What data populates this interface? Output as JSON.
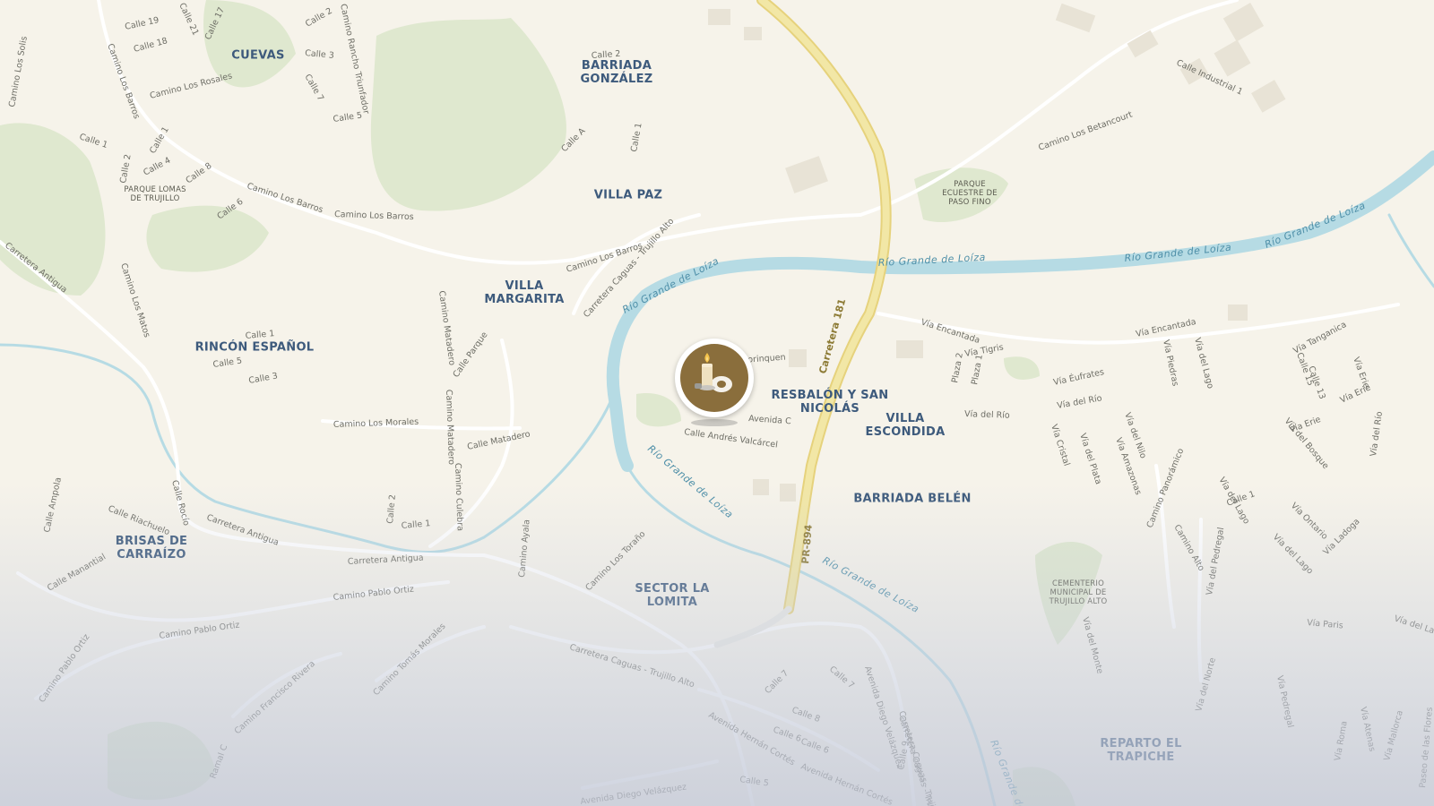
{
  "map": {
    "neighborhoods": [
      {
        "id": "cuevas",
        "name": "CUEVAS"
      },
      {
        "id": "barriada-gonzalez",
        "name": "BARRIADA\nGONZÁLEZ"
      },
      {
        "id": "villa-paz",
        "name": "VILLA PAZ"
      },
      {
        "id": "villa-margarita",
        "name": "VILLA\nMARGARITA"
      },
      {
        "id": "rincon-espanol",
        "name": "RINCÓN ESPAÑOL"
      },
      {
        "id": "resbalon",
        "name": "RESBALÓN Y SAN\nNICOLÁS"
      },
      {
        "id": "villa-escondida",
        "name": "VILLA\nESCONDIDA"
      },
      {
        "id": "barriada-belen",
        "name": "BARRIADA BELÉN"
      },
      {
        "id": "brisas",
        "name": "BRISAS DE\nCARRAÍZO"
      },
      {
        "id": "sector-la-lomita",
        "name": "SECTOR LA\nLOMITA"
      },
      {
        "id": "reparto-el-trapiche",
        "name": "REPARTO EL\nTRAPICHE"
      }
    ],
    "pois": [
      {
        "id": "parque-lomas",
        "name": "PARQUE LOMAS\nDE TRUJILLO"
      },
      {
        "id": "parque-ecuestre",
        "name": "PARQUE\nECUESTRE DE\nPASO FINO"
      },
      {
        "id": "cementerio",
        "name": "CEMENTERIO\nMUNICIPAL DE\nTRUJILLO ALTO"
      }
    ],
    "rivers": [
      {
        "id": "r1",
        "name": "Río Grande de Loíza"
      },
      {
        "id": "r2",
        "name": "Río Grande de Loíza"
      },
      {
        "id": "r3",
        "name": "Río Grande de Loíza"
      },
      {
        "id": "r4",
        "name": "Río Grande de Loíza"
      },
      {
        "id": "r5",
        "name": "Río Grande de Loíza"
      },
      {
        "id": "r6",
        "name": "Río Grande de Loíza"
      },
      {
        "id": "r7",
        "name": "Río Grande de Loíza"
      }
    ],
    "highways": [
      {
        "id": "carretera-181",
        "name": "Carretera 181"
      },
      {
        "id": "pr-894",
        "name": "PR-894"
      }
    ],
    "streets": [
      {
        "id": "s1",
        "name": "Camino Los Barros"
      },
      {
        "id": "s2",
        "name": "Camino Los Barros"
      },
      {
        "id": "s3",
        "name": "Camino Los Barros"
      },
      {
        "id": "s4",
        "name": "Camino Los Barros"
      },
      {
        "id": "s5",
        "name": "Carretera Caguas - Trujillo Alto"
      },
      {
        "id": "s6",
        "name": "Carretera Caguas - Trujillo Alto"
      },
      {
        "id": "s7",
        "name": "Carretera Caguas - Trujillo Alto"
      },
      {
        "id": "s8",
        "name": "Carretera Antigua"
      },
      {
        "id": "s9",
        "name": "Carretera Antigua"
      },
      {
        "id": "s10",
        "name": "Carretera Antigua"
      },
      {
        "id": "s11",
        "name": "Camino Los Rosales"
      },
      {
        "id": "s12",
        "name": "Camino Rancho Triunfador"
      },
      {
        "id": "s13",
        "name": "Camino Los Solis"
      },
      {
        "id": "s14",
        "name": "Camino Los Matos"
      },
      {
        "id": "s15",
        "name": "Camino Matadero"
      },
      {
        "id": "s16",
        "name": "Camino Matadero"
      },
      {
        "id": "s17",
        "name": "Calle Matadero"
      },
      {
        "id": "s18",
        "name": "Camino Culebra"
      },
      {
        "id": "s19",
        "name": "Camino Los Morales"
      },
      {
        "id": "s20",
        "name": "Calle Parque"
      },
      {
        "id": "s21",
        "name": "Calle Andrés Valcárcel"
      },
      {
        "id": "s22",
        "name": "Avenida C"
      },
      {
        "id": "s23",
        "name": "Borinquen"
      },
      {
        "id": "s24",
        "name": "Calle Ampola"
      },
      {
        "id": "s25",
        "name": "Calle Riachuelo"
      },
      {
        "id": "s26",
        "name": "Calle Rocío"
      },
      {
        "id": "s27",
        "name": "Calle Manantial"
      },
      {
        "id": "s28",
        "name": "Camino Pablo Ortiz"
      },
      {
        "id": "s29",
        "name": "Camino Pablo Ortiz"
      },
      {
        "id": "s30",
        "name": "Camino Pablo Ortiz"
      },
      {
        "id": "s31",
        "name": "Camino Tomás Morales"
      },
      {
        "id": "s32",
        "name": "Camino Francisco Rivera"
      },
      {
        "id": "s33",
        "name": "Camino Ayala"
      },
      {
        "id": "s34",
        "name": "Camino Los Toraño"
      },
      {
        "id": "s35",
        "name": "Ramal C"
      },
      {
        "id": "s36",
        "name": "Avenida Diego Velázquez"
      },
      {
        "id": "s37",
        "name": "Avenida Diego Velázquez"
      },
      {
        "id": "s38",
        "name": "Avenida Hernán Cortés"
      },
      {
        "id": "s39",
        "name": "Avenida Hernán Cortés"
      },
      {
        "id": "s40",
        "name": "Camino Los Betancourt"
      },
      {
        "id": "s41",
        "name": "Calle Industrial 1"
      },
      {
        "id": "s42",
        "name": "Vía Encantada"
      },
      {
        "id": "s43",
        "name": "Vía Encantada"
      },
      {
        "id": "s44",
        "name": "Vía Tigris"
      },
      {
        "id": "s45",
        "name": "Vía Éufrates"
      },
      {
        "id": "s46",
        "name": "Vía del Río"
      },
      {
        "id": "s47",
        "name": "Vía del Río"
      },
      {
        "id": "s48",
        "name": "Vía Piedras"
      },
      {
        "id": "s49",
        "name": "Vía del Lago"
      },
      {
        "id": "s50",
        "name": "Vía Cristal"
      },
      {
        "id": "s51",
        "name": "Vía del Plata"
      },
      {
        "id": "s52",
        "name": "Vía del Nilo"
      },
      {
        "id": "s53",
        "name": "Vía Amazonas"
      },
      {
        "id": "s54",
        "name": "Camino Panorámico"
      },
      {
        "id": "s55",
        "name": "Camino Alto"
      },
      {
        "id": "s56",
        "name": "Vía del Lago"
      },
      {
        "id": "s57",
        "name": "Vía del Pedregal"
      },
      {
        "id": "s58",
        "name": "Vía Tanganica"
      },
      {
        "id": "s59",
        "name": "Vía Erie"
      },
      {
        "id": "s60",
        "name": "Vía Erie"
      },
      {
        "id": "s61",
        "name": "Vía Erie"
      },
      {
        "id": "s62",
        "name": "Vía del Bosque"
      },
      {
        "id": "s63",
        "name": "Vía Ontario"
      },
      {
        "id": "s64",
        "name": "Vía Ladoga"
      },
      {
        "id": "s65",
        "name": "Vía del Lago"
      },
      {
        "id": "s66",
        "name": "Vía del Río"
      },
      {
        "id": "s67",
        "name": "Vía Paris"
      },
      {
        "id": "s68",
        "name": "Vía del Lago"
      },
      {
        "id": "s69",
        "name": "Vía del Monte"
      },
      {
        "id": "s70",
        "name": "Vía del Norte"
      },
      {
        "id": "s71",
        "name": "Vía Pedregal"
      },
      {
        "id": "s72",
        "name": "Vía Roma"
      },
      {
        "id": "s73",
        "name": "Vía Atenas"
      },
      {
        "id": "s74",
        "name": "Vía Mallorca"
      },
      {
        "id": "s75",
        "name": "Paseo de las Flores"
      },
      {
        "id": "s76",
        "name": "Carretera Caguas - Trujillo Alto"
      },
      {
        "id": "s77",
        "name": "Plaza 2"
      },
      {
        "id": "s78",
        "name": "Plaza 1"
      },
      {
        "id": "s79",
        "name": "Calle 1"
      },
      {
        "id": "s80",
        "name": "Calle 1"
      },
      {
        "id": "s81",
        "name": "Calle 1"
      },
      {
        "id": "s82",
        "name": "Calle 1"
      },
      {
        "id": "s83",
        "name": "Calle 1"
      },
      {
        "id": "s84",
        "name": "Calle 1"
      },
      {
        "id": "s85",
        "name": "Calle 2"
      },
      {
        "id": "s86",
        "name": "Calle 2"
      },
      {
        "id": "s87",
        "name": "Calle 2"
      },
      {
        "id": "s88",
        "name": "Calle 2"
      },
      {
        "id": "s89",
        "name": "Calle 3"
      },
      {
        "id": "s90",
        "name": "Calle 3"
      },
      {
        "id": "s91",
        "name": "Calle 4"
      },
      {
        "id": "s92",
        "name": "Calle 5"
      },
      {
        "id": "s93",
        "name": "Calle 5"
      },
      {
        "id": "s94",
        "name": "Calle 5"
      },
      {
        "id": "s95",
        "name": "Calle 6"
      },
      {
        "id": "s96",
        "name": "Calle 6"
      },
      {
        "id": "s97",
        "name": "Calle 6"
      },
      {
        "id": "s98",
        "name": "Calle 7"
      },
      {
        "id": "s99",
        "name": "Calle 7"
      },
      {
        "id": "s100",
        "name": "Calle 7"
      },
      {
        "id": "s101",
        "name": "Calle 8"
      },
      {
        "id": "s102",
        "name": "Calle 8"
      },
      {
        "id": "s103",
        "name": "Calle 9"
      },
      {
        "id": "s104",
        "name": "Calle 13"
      },
      {
        "id": "s105",
        "name": "Calle 15"
      },
      {
        "id": "s106",
        "name": "Calle 17"
      },
      {
        "id": "s107",
        "name": "Calle 18"
      },
      {
        "id": "s108",
        "name": "Calle 19"
      },
      {
        "id": "s109",
        "name": "Calle 21"
      },
      {
        "id": "s110",
        "name": "Calle A"
      },
      {
        "id": "s111",
        "name": "Río Grande de Loíza"
      }
    ]
  },
  "marker": {
    "icon": "candle-icon"
  },
  "colors": {
    "land": "#f6f3ea",
    "park": "#dfe8cf",
    "water": "#b6dbe4",
    "highway": "#f2e7a6",
    "highway_casing": "#e6d27c",
    "road": "#ffffff",
    "marker": "#8a6e3c"
  }
}
